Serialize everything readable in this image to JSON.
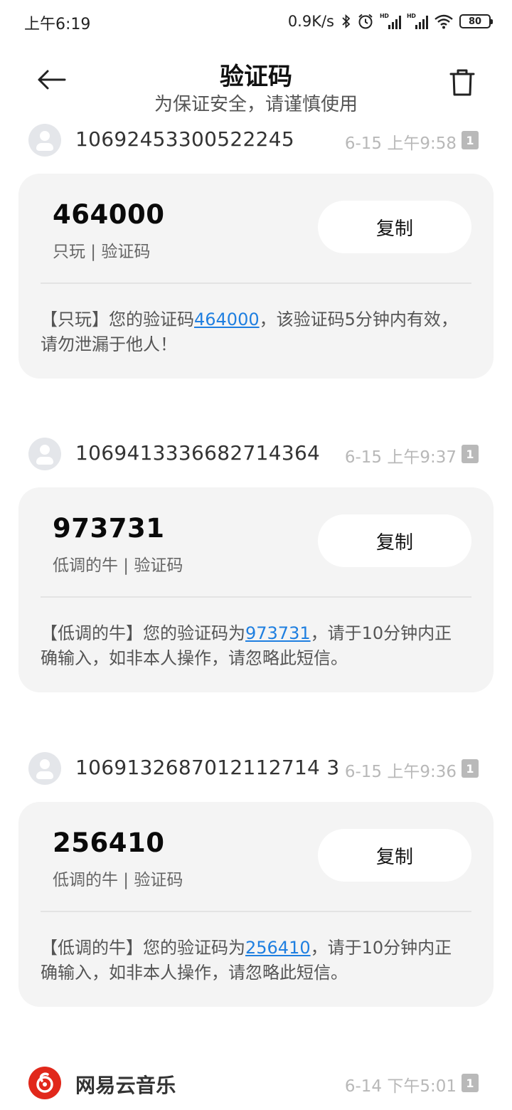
{
  "status_bar": {
    "time": "上午6:19",
    "network_speed": "0.9K/s",
    "hd_label": "HD",
    "battery": "80"
  },
  "header": {
    "title": "验证码",
    "subtitle": "为保证安全，请谨慎使用"
  },
  "messages": [
    {
      "sender": "10692453300522245",
      "time": "6-15 上午9:58",
      "sim": "1",
      "code": "464000",
      "label": "只玩 | 验证码",
      "copy_label": "复制",
      "body_before": "【只玩】您的验证码",
      "body_code": "464000",
      "body_after": "，该验证码5分钟内有效，请勿泄漏于他人！"
    },
    {
      "sender": "1069413336682714364",
      "time": "6-15 上午9:37",
      "sim": "1",
      "code": "973731",
      "label": "低调的牛 | 验证码",
      "copy_label": "复制",
      "body_before": "【低调的牛】您的验证码为",
      "body_code": "973731",
      "body_after": "，请于10分钟内正确输入，如非本人操作，请忽略此短信。"
    },
    {
      "sender": "1069132687012112714 3",
      "time": "6-15 上午9:36",
      "sim": "1",
      "code": "256410",
      "label": "低调的牛 | 验证码",
      "copy_label": "复制",
      "body_before": "【低调的牛】您的验证码为",
      "body_code": "256410",
      "body_after": "，请于10分钟内正确输入，如非本人操作，请忽略此短信。"
    },
    {
      "sender": "网易云音乐",
      "time": "6-14 下午5:01",
      "sim": "1"
    }
  ],
  "colors": {
    "link": "#1f7fe0",
    "card_bg": "#f4f4f4",
    "netease_red": "#e1281b"
  },
  "icons": {
    "back": "arrow-left-icon",
    "delete": "trash-icon",
    "avatar": "person-avatar-icon",
    "netease": "netease-music-logo-icon"
  }
}
